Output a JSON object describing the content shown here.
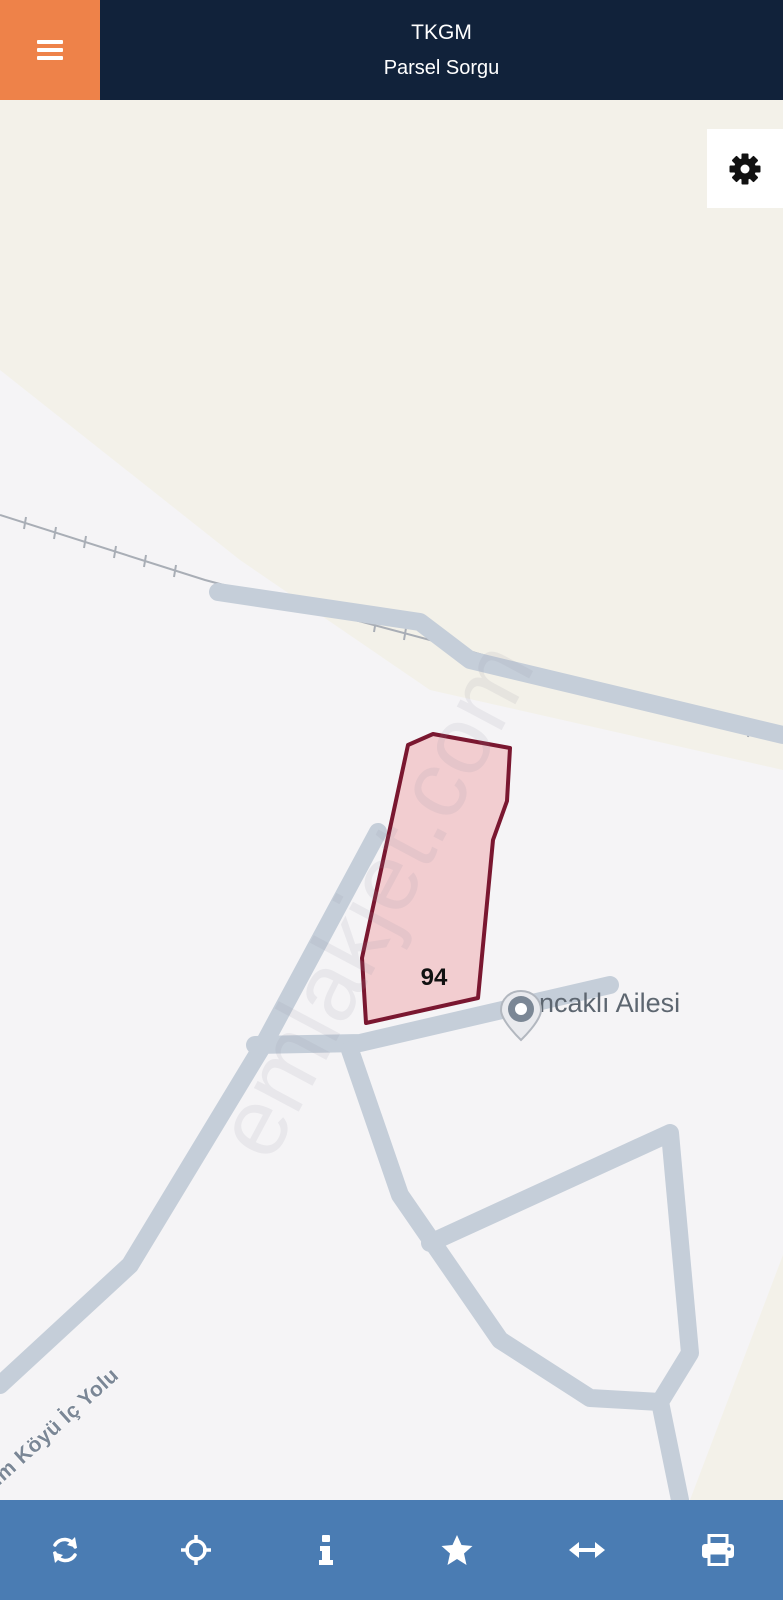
{
  "header": {
    "title": "TKGM",
    "subtitle": "Parsel Sorgu",
    "menu_icon": "hamburger-menu-icon",
    "background_color": "#11223a",
    "menu_color": "#ee8249"
  },
  "map": {
    "settings_icon": "gear-icon",
    "parcel": {
      "number": "94",
      "fill_color": "#f2cdd0",
      "stroke_color": "#7a1730"
    },
    "poi": {
      "label": "Sancaklı Ailesi",
      "icon": "map-pin-icon"
    },
    "road_label": "lim Köyü İç Yolu",
    "watermark": "emlakjet.com",
    "colors": {
      "land": "#f5f4f6",
      "field": "#f3f1e9",
      "road": "#c5ced9"
    }
  },
  "toolbar": {
    "background_color": "#4a7cb3",
    "buttons": [
      {
        "name": "refresh",
        "icon": "refresh-icon"
      },
      {
        "name": "locate",
        "icon": "crosshair-icon"
      },
      {
        "name": "info",
        "icon": "info-icon"
      },
      {
        "name": "favorite",
        "icon": "star-icon"
      },
      {
        "name": "measure",
        "icon": "horizontal-arrows-icon"
      },
      {
        "name": "print",
        "icon": "printer-icon"
      }
    ]
  }
}
